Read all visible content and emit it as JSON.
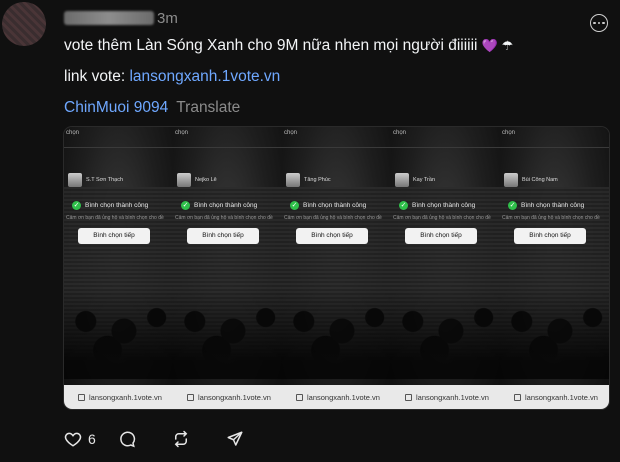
{
  "post": {
    "time": "3m",
    "text": "vote thêm Làn Sóng Xanh cho 9M nữa nhen mọi người điiiiii",
    "emoji": "💜 ☂",
    "link_label": "link vote:",
    "link_url": "lansongxanh.1vote.vn",
    "mention": "ChinMuoi 9094",
    "translate": "Translate"
  },
  "media": {
    "panels": [
      {
        "top": "chọn",
        "candidate": "S.T Sơn Thạch",
        "success": "Bình chọn thành công",
        "thanks": "Cảm ơn bạn đã ủng hộ và bình chọn cho đề",
        "button": "Bình chọn tiếp",
        "url": "lansongxanh.1vote.vn"
      },
      {
        "top": "chọn",
        "candidate": "Nejko Lê",
        "success": "Bình chọn thành công",
        "thanks": "Cảm ơn bạn đã ủng hộ và bình chọn cho đề",
        "button": "Bình chọn tiếp",
        "url": "lansongxanh.1vote.vn"
      },
      {
        "top": "chọn",
        "candidate": "Tăng Phúc",
        "success": "Bình chọn thành công",
        "thanks": "Cảm ơn bạn đã ủng hộ và bình chọn cho đề",
        "button": "Bình chọn tiếp",
        "url": "lansongxanh.1vote.vn"
      },
      {
        "top": "chọn",
        "candidate": "Kay Trần",
        "success": "Bình chọn thành công",
        "thanks": "Cảm ơn bạn đã ủng hộ và bình chọn cho đề",
        "button": "Bình chọn tiếp",
        "url": "lansongxanh.1vote.vn"
      },
      {
        "top": "chọn",
        "candidate": "Bùi Công Nam",
        "success": "Bình chọn thành công",
        "thanks": "Cảm ơn bạn đã ủng hộ và bình chọn cho đề",
        "button": "Bình chọn tiếp",
        "url": "lansongxanh.1vote.vn"
      }
    ]
  },
  "actions": {
    "like_count": "6",
    "icons": [
      "heart-icon",
      "comment-icon",
      "repost-icon",
      "share-icon"
    ]
  },
  "colors": {
    "background": "#101010",
    "link": "#6fa8ff",
    "muted": "#8b8b8b",
    "success": "#2fbf4a"
  }
}
